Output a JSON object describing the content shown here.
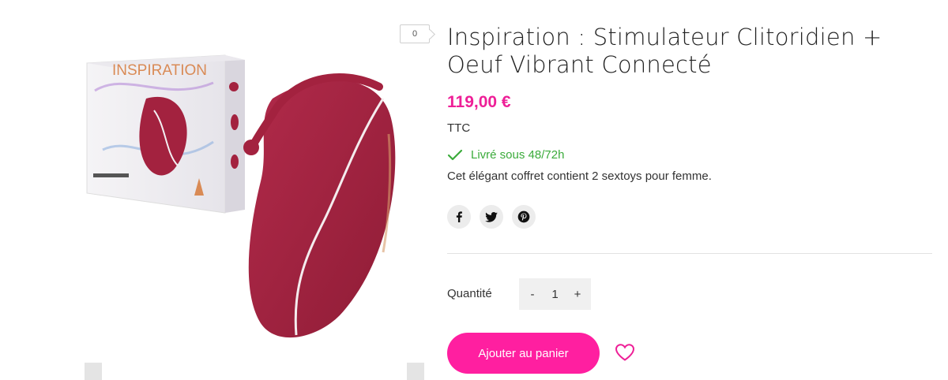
{
  "compare": {
    "count": "0"
  },
  "product": {
    "title_line1": "Inspiration : Stimulateur Clitoridien +",
    "title_line2": "Oeuf Vibrant Connecté",
    "price": "119,00 €",
    "tax_label": "TTC",
    "delivery": "Livré sous 48/72h",
    "description": "Cet élégant coffret contient 2 sextoys pour femme.",
    "box_brand": "INSPIRATION"
  },
  "social": {
    "icons": [
      "facebook-icon",
      "twitter-icon",
      "pinterest-icon"
    ]
  },
  "quantity": {
    "label": "Quantité",
    "value": "1",
    "minus": "-",
    "plus": "+"
  },
  "cart": {
    "button_label": "Ajouter au panier"
  },
  "colors": {
    "accent": "#ff1fa0",
    "price": "#ee1f97",
    "success": "#3bab3b",
    "product": "#a3223f"
  }
}
